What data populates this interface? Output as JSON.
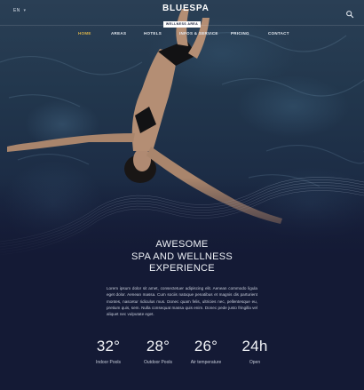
{
  "header": {
    "language": "EN",
    "brand": "BLUESPA",
    "tagline": "WELLNESS AREA"
  },
  "nav": {
    "items": [
      {
        "label": "HOME",
        "active": true
      },
      {
        "label": "AREAS"
      },
      {
        "label": "HOTELS"
      },
      {
        "label": "INFOS & SERVICE"
      },
      {
        "label": "PRICING"
      },
      {
        "label": "CONTACT"
      }
    ]
  },
  "hero": {
    "image_subject": "woman floating in pool"
  },
  "main": {
    "headline_line1": "AWESOME",
    "headline_line2": "SPA AND WELLNESS",
    "headline_line3": "EXPERIENCE",
    "body": "Lorem ipsum dolor sit amet, consectetuer adipiscing elit. Aenean commodo ligula eget dolor. Aenean massa. Cum sociis natoque penatibus et magnis dis parturient montes, nascetur ridiculus mus. Donec quam felis, ultricies nec, pellentesque eu, pretium quis, sem. Nulla consequat massa quis enim. Donec pede justo fringilla vel aliquet nec vulputate eget."
  },
  "stats": [
    {
      "value": "32°",
      "label": "Indoor Pools"
    },
    {
      "value": "28°",
      "label": "Outdoor Pools"
    },
    {
      "value": "26°",
      "label": "Air temperature"
    },
    {
      "value": "24h",
      "label": "Open"
    }
  ],
  "colors": {
    "background": "#141a35",
    "accent": "#d8b24a",
    "text": "#ffffff",
    "muted_text": "#c6ccd9"
  },
  "icons": {
    "search": "search-icon",
    "language_dropdown": "chevron-down-icon"
  }
}
